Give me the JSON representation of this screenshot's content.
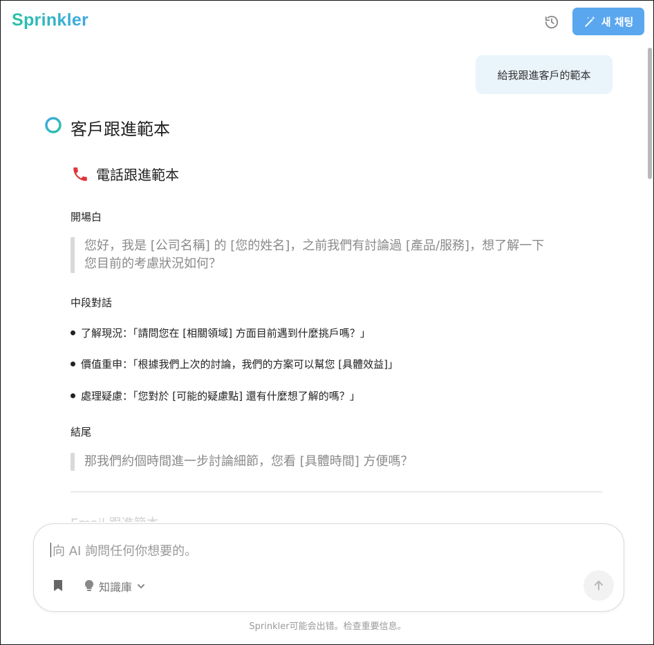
{
  "app": {
    "name": "Sprinkler"
  },
  "header": {
    "new_chat_label": "새 채팅",
    "history_icon": "history-icon"
  },
  "chat": {
    "user_message": "給我跟進客戶的範本",
    "response_title": "客戶跟進範本",
    "section_title": "電話跟進範本",
    "opening_label": "開場白",
    "opening_text_line1": "您好，我是 [公司名稱] 的 [您的姓名]，之前我們有討論過 [產品/服務]，想了解一下",
    "opening_text_line2": "您目前的考慮狀況如何？",
    "middle_label": "中段對話",
    "bullets": [
      "了解現況：「請問您在 [相關領域] 方面目前遇到什麼挑戶嗎？」",
      "價值重申：「根據我們上次的討論，我們的方案可以幫您 [具體效益]」",
      "處理疑慮：「您對於 [可能的疑慮點] 還有什麼想了解的嗎？」"
    ],
    "closing_label": "結尾",
    "closing_text": "那我們約個時間進一步討論細節，您看 [具體時間] 方便嗎？",
    "faded_next_section": "Email 跟進範本"
  },
  "composer": {
    "placeholder": "向 AI 詢問任何你想要的。",
    "knowledge_base_label": "知識庫"
  },
  "footer": {
    "disclaimer": "Sprinkler可能会出错。检查重要信息。"
  },
  "colors": {
    "accent": "#5aa7ef",
    "user_bubble": "#eaf4fb",
    "logo_start": "#27c2a4",
    "logo_end": "#3fa7e6"
  }
}
